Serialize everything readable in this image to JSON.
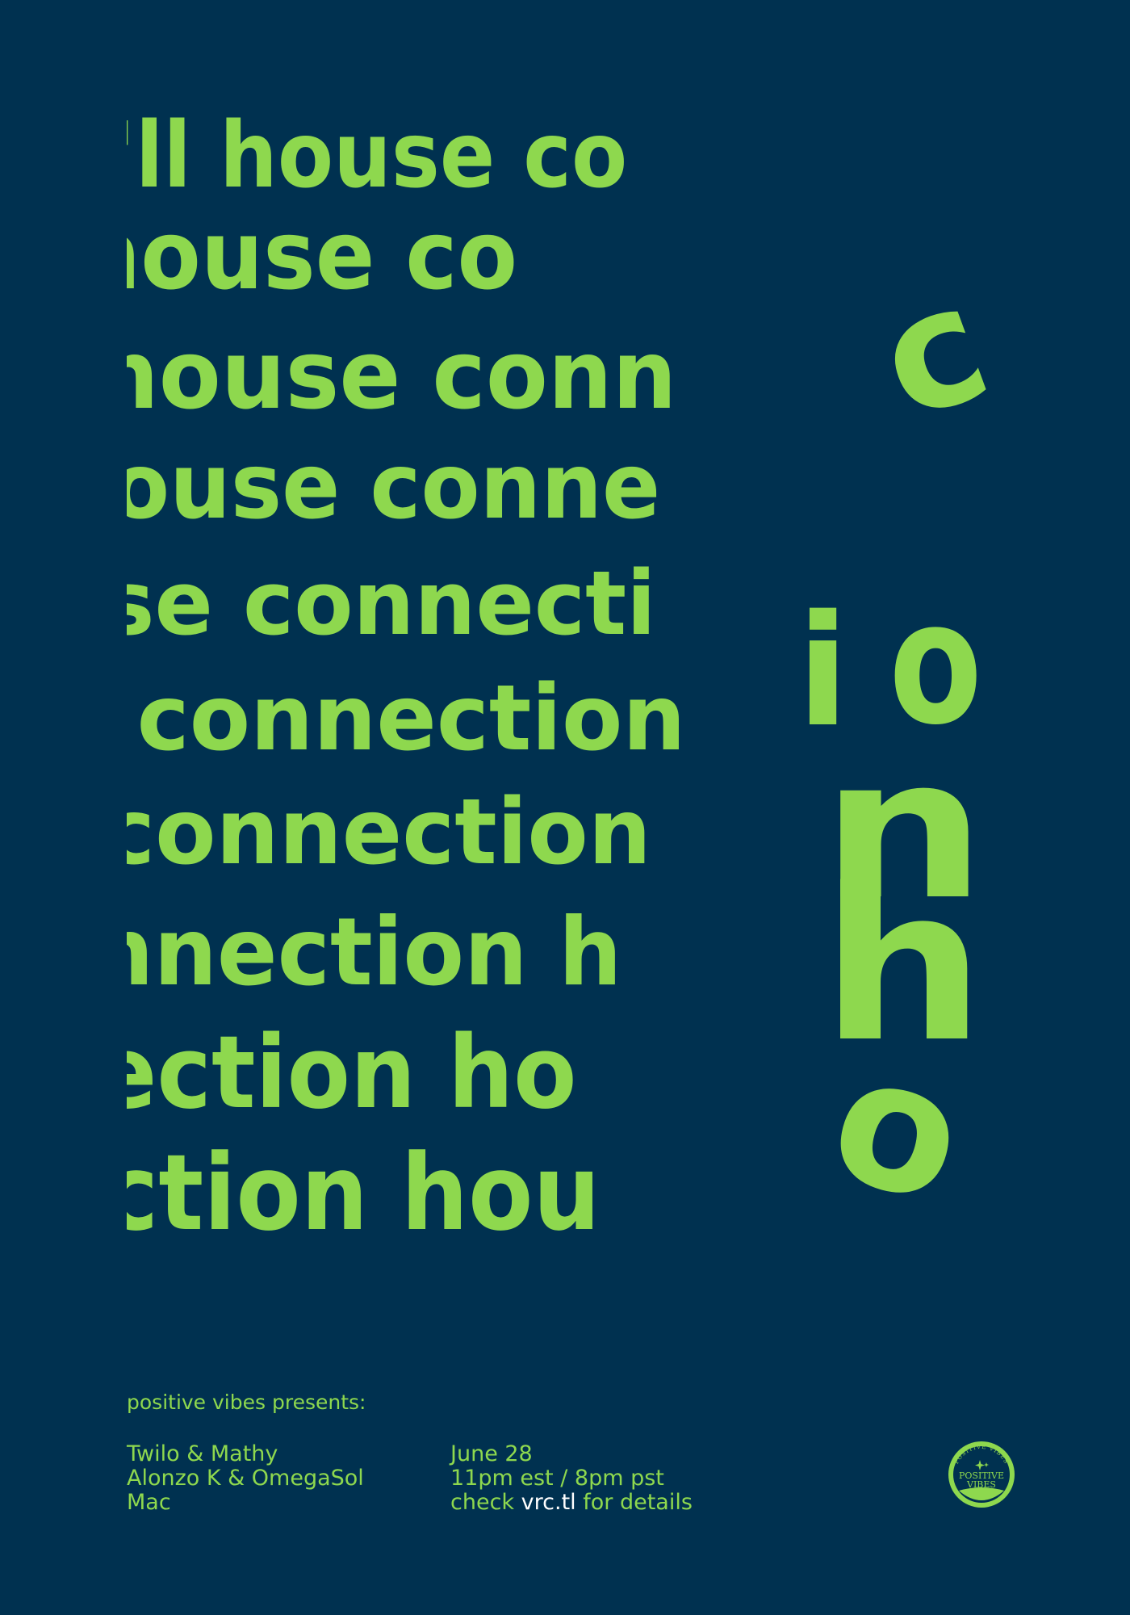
{
  "poster": {
    "art_lines": [
      "'ll house co",
      "house co",
      "house conn",
      "ouse conne",
      "use connecti",
      "e connection",
      "connection",
      "nnection h",
      "ection ho",
      "ction hou"
    ],
    "art_glyphs": {
      "c": "c",
      "i": "i",
      "o": "o",
      "n": "n",
      "h": "h",
      "o2": "o"
    },
    "colors": {
      "background": "#003150",
      "accent": "#8ed84e",
      "link": "#ffffff"
    }
  },
  "footer": {
    "intro": "positive vibes presents:",
    "lineup": [
      "Twilo & Mathy",
      "Alonzo K & OmegaSol",
      "Mac"
    ],
    "date": "June 28",
    "time": "11pm est / 8pm pst",
    "details_prefix": "check",
    "details_link": "vrc.tl",
    "details_suffix": "for details"
  },
  "logo": {
    "arc_text": "POSITIVE VIBES",
    "main_text_line1": "POSITIVE",
    "main_text_line2": "VIBES",
    "icon": "sparkle-icon"
  }
}
